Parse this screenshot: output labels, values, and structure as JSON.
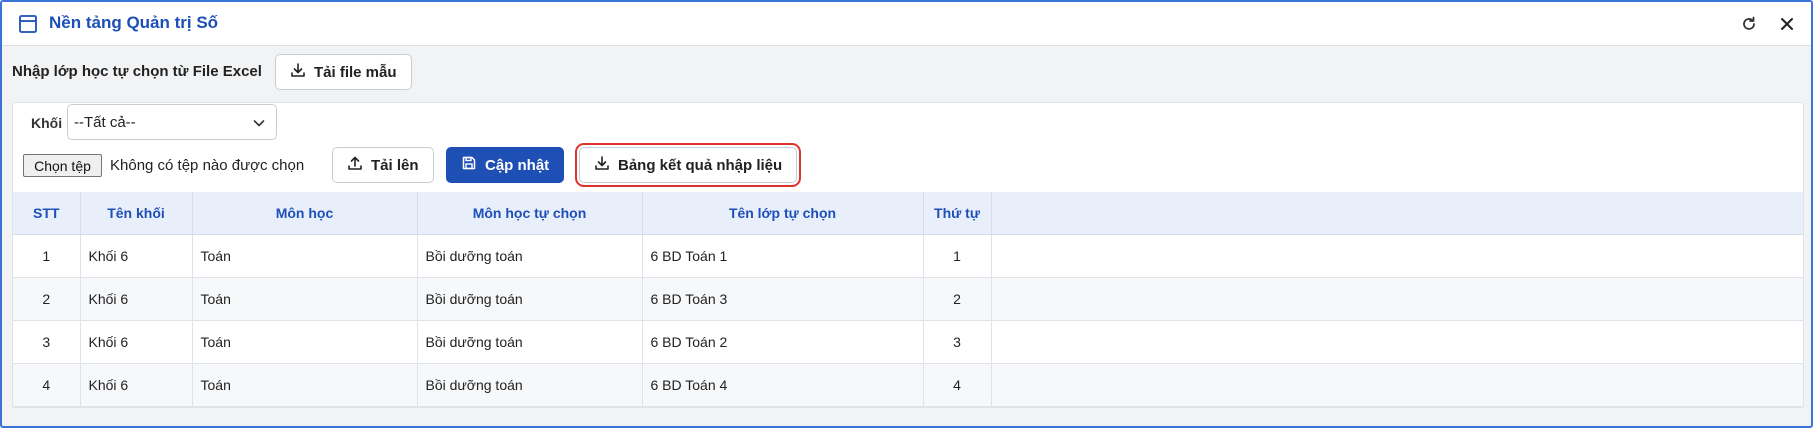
{
  "window": {
    "title": "Nền tảng Quản trị Số"
  },
  "icons": {
    "app": "window-icon",
    "refresh": "refresh-icon",
    "close": "close-icon",
    "download": "download-icon",
    "upload": "upload-icon",
    "save": "save-icon",
    "dropdown": "chevron-down-icon"
  },
  "colors": {
    "accent": "#1d4fb8",
    "primary_button": "#1e4fb4",
    "highlight": "#e0322d",
    "header_bg": "#e9effa"
  },
  "import": {
    "label": "Nhập lớp học tự chọn từ File Excel",
    "template_button": "Tải file mẫu"
  },
  "filter": {
    "khoi_label": "Khối",
    "khoi_value": "--Tất cả--"
  },
  "file": {
    "choose_button": "Chọn tệp",
    "status": "Không có tệp nào được chọn",
    "upload_button": "Tải lên",
    "update_button": "Cập nhật",
    "result_button": "Bảng kết quả nhập liệu"
  },
  "table": {
    "headers": [
      "STT",
      "Tên khối",
      "Môn học",
      "Môn học tự chọn",
      "Tên lớp tự chọn",
      "Thứ tự",
      ""
    ],
    "rows": [
      [
        "1",
        "Khối 6",
        "Toán",
        "Bồi dưỡng toán",
        "6 BD Toán 1",
        "1"
      ],
      [
        "2",
        "Khối 6",
        "Toán",
        "Bồi dưỡng toán",
        "6 BD Toán 3",
        "2"
      ],
      [
        "3",
        "Khối 6",
        "Toán",
        "Bồi dưỡng toán",
        "6 BD Toán 2",
        "3"
      ],
      [
        "4",
        "Khối 6",
        "Toán",
        "Bồi dưỡng toán",
        "6 BD Toán 4",
        "4"
      ]
    ]
  }
}
